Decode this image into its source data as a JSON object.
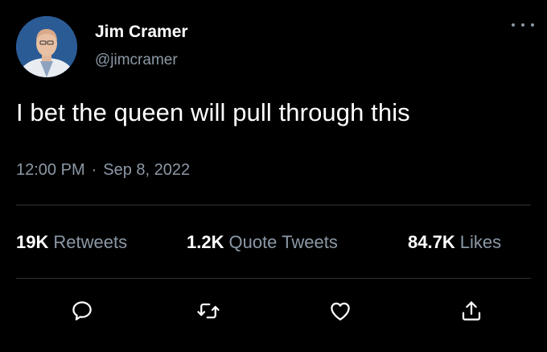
{
  "author": {
    "name": "Jim Cramer",
    "handle": "@jimcramer",
    "avatar_icon": "avatar-photo"
  },
  "tweet": {
    "text": "I bet the queen will pull through this",
    "time": "12:00 PM",
    "separator": "·",
    "date": "Sep 8, 2022"
  },
  "stats": {
    "retweets": {
      "count": "19K",
      "label": "Retweets"
    },
    "quotes": {
      "count": "1.2K",
      "label": "Quote Tweets"
    },
    "likes": {
      "count": "84.7K",
      "label": "Likes"
    }
  },
  "actions": {
    "reply_icon": "reply-icon",
    "retweet_icon": "retweet-icon",
    "like_icon": "heart-icon",
    "share_icon": "share-icon"
  },
  "colors": {
    "background": "#000000",
    "primary_text": "#ffffff",
    "secondary_text": "#8b98a5",
    "divider": "#2f3336"
  }
}
